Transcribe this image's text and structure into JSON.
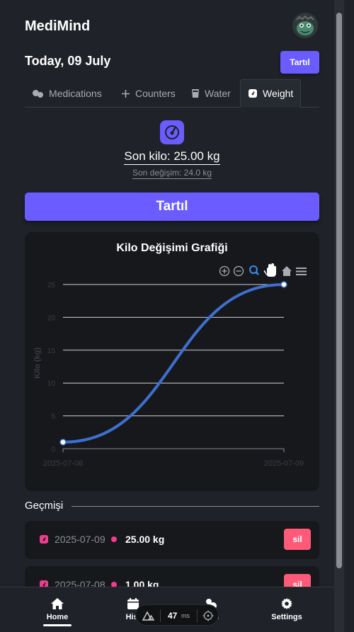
{
  "app": {
    "title": "MediMind"
  },
  "date_header": {
    "title": "Today, 09 July",
    "weigh_button": "Tartıl"
  },
  "tabs": [
    {
      "label": "Medications",
      "icon": "pills-icon",
      "active": false
    },
    {
      "label": "Counters",
      "icon": "plus-icon",
      "active": false
    },
    {
      "label": "Water",
      "icon": "cup-icon",
      "active": false
    },
    {
      "label": "Weight",
      "icon": "scale-icon",
      "active": true
    }
  ],
  "weight": {
    "last_weight": "Son kilo: 25.00 kg",
    "last_change": "Son değişim: 24.0 kg",
    "weigh_button": "Tartıl"
  },
  "chart_data": {
    "type": "line",
    "title": "Kilo Değişimi Grafiği",
    "ylabel": "Kilo (kg)",
    "xlabel": "",
    "x": [
      "2025-07-08",
      "2025-07-09"
    ],
    "series": [
      {
        "values": [
          1.0,
          25.0
        ]
      }
    ],
    "ylim": [
      0,
      25
    ],
    "yticks": [
      "0",
      "5",
      "10",
      "15",
      "20",
      "25"
    ],
    "grid": true,
    "color": "#3e6fd0",
    "toolbar": [
      "zoom-in-icon",
      "zoom-out-icon",
      "zoom-select-icon",
      "pan-icon",
      "home-icon",
      "menu-icon"
    ]
  },
  "history": {
    "label": "Geçmişi",
    "items": [
      {
        "date": "2025-07-09",
        "value": "25.00 kg",
        "delete": "sil"
      },
      {
        "date": "2025-07-08",
        "value": "1.00 kg",
        "delete": "sil"
      }
    ]
  },
  "nav": {
    "items": [
      {
        "label": "Home",
        "icon": "home-icon"
      },
      {
        "label": "Hist",
        "icon": "calendar-icon"
      },
      {
        "label": "ions",
        "icon": "pills-icon"
      },
      {
        "label": "Settings",
        "icon": "gear-icon"
      }
    ]
  },
  "perf_overlay": {
    "value": "47",
    "unit": "ms"
  },
  "colors": {
    "accent": "#6a5cff",
    "pink": "#ef3d8d",
    "delete": "#ff5a7a",
    "line": "#3e6fd0"
  }
}
